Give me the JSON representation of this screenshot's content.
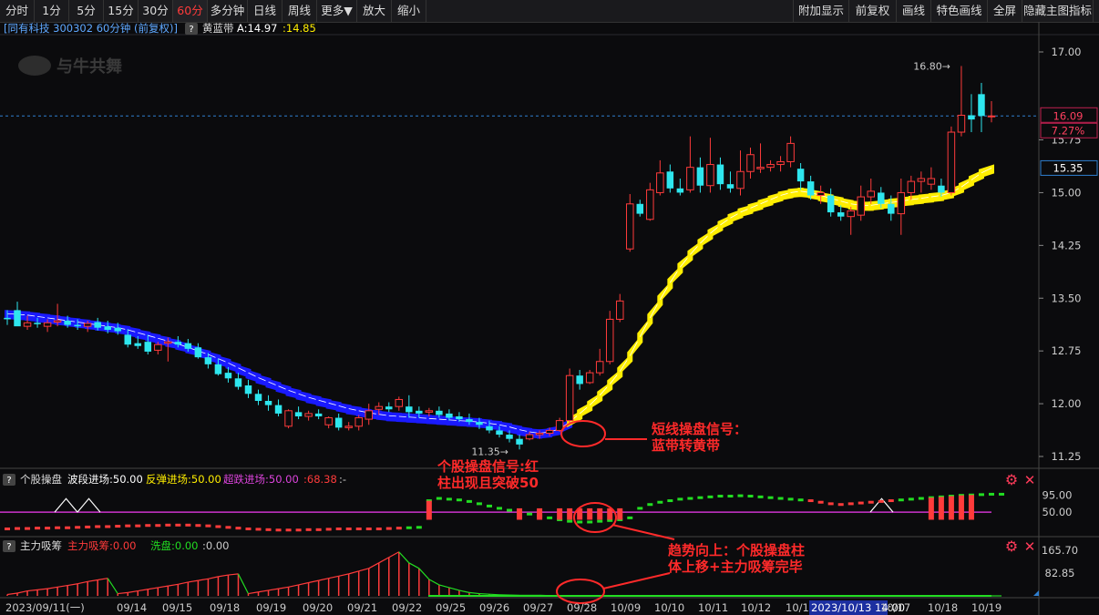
{
  "toolbar": {
    "left_items": [
      "分时",
      "1分",
      "5分",
      "15分",
      "30分",
      "60分",
      "多分钟",
      "日线",
      "周线",
      "更多▼",
      "放大",
      "缩小"
    ],
    "active_item": "60分",
    "right_items": [
      "附加显示",
      "前复权",
      "画线",
      "特色画线",
      "全屏",
      "隐藏主图指标"
    ]
  },
  "main_header": {
    "stock": "同有科技 300302 60分钟",
    "adjust": "(前复权)",
    "indicator": "黄蓝带",
    "indicator_a": "A:14.97",
    "indicator_b": ":14.85"
  },
  "watermark": "与牛共舞",
  "price_axis": {
    "ticks": [
      "17.00",
      "15.75",
      "15.00",
      "14.25",
      "13.50",
      "12.75",
      "12.00",
      "11.25"
    ],
    "last_price": "16.09",
    "last_pct": "7.27%",
    "band_value": "15.35"
  },
  "high_label": "16.80",
  "low_label": "11.35",
  "sub1_header": {
    "name": "个股操盘",
    "a_label": "波段进场:50.00",
    "b_label": "反弹进场:50.00",
    "c_label": "超跌进场:50.00",
    "d_label": ":68.38",
    "e_label": ":-"
  },
  "sub1_axis": [
    "95.00",
    "50.00"
  ],
  "sub2_header": {
    "name": "主力吸筹",
    "a_label": "主力吸筹:0.00",
    "b_label": "洗盘:0.00",
    "c_label": ":0.00"
  },
  "sub2_axis": [
    "165.70",
    "82.85"
  ],
  "date_axis": [
    "2023/09/11(一)",
    "09/14",
    "09/15",
    "09/18",
    "09/19",
    "09/20",
    "09/21",
    "09/22",
    "09/25",
    "09/26",
    "09/27",
    "09/28",
    "10/09",
    "10/10",
    "10/11",
    "10/12",
    "10/13",
    "2023/10/13 14:00",
    "10/17",
    "10/18",
    "10/19"
  ],
  "annotations": {
    "short_signal": [
      "短线操盘信号：",
      "蓝带转黄带"
    ],
    "stock_signal": [
      "个股操盘信号:红",
      "柱出现且突破50"
    ],
    "trend_signal": [
      "趋势向上：个股操盘柱",
      "体上移+主力吸筹完毕"
    ]
  },
  "colors": {
    "up": "#ff3b3b",
    "down": "#2ee6ee",
    "blue_band": "#1a1aff",
    "yellow_band": "#ffee00",
    "green": "#22dd22",
    "magenta": "#cc33cc",
    "annotation": "#ff2a2a"
  },
  "chart_data": {
    "type": "candlestick",
    "candles": [
      {
        "o": 13.22,
        "h": 13.33,
        "l": 13.12,
        "c": 13.2
      },
      {
        "o": 13.33,
        "h": 13.45,
        "l": 13.15,
        "c": 13.1
      },
      {
        "o": 13.1,
        "h": 13.25,
        "l": 13.05,
        "c": 13.15
      },
      {
        "o": 13.15,
        "h": 13.22,
        "l": 13.08,
        "c": 13.13
      },
      {
        "o": 13.1,
        "h": 13.2,
        "l": 13.02,
        "c": 13.15
      },
      {
        "o": 13.16,
        "h": 13.42,
        "l": 13.1,
        "c": 13.18
      },
      {
        "o": 13.18,
        "h": 13.25,
        "l": 13.08,
        "c": 13.12
      },
      {
        "o": 13.12,
        "h": 13.2,
        "l": 13.05,
        "c": 13.1
      },
      {
        "o": 13.1,
        "h": 13.18,
        "l": 13.02,
        "c": 13.14
      },
      {
        "o": 13.16,
        "h": 13.22,
        "l": 13.04,
        "c": 13.08
      },
      {
        "o": 13.1,
        "h": 13.18,
        "l": 13.0,
        "c": 13.05
      },
      {
        "o": 13.08,
        "h": 13.15,
        "l": 12.98,
        "c": 13.03
      },
      {
        "o": 12.98,
        "h": 13.06,
        "l": 12.8,
        "c": 12.84
      },
      {
        "o": 12.86,
        "h": 12.96,
        "l": 12.78,
        "c": 12.82
      },
      {
        "o": 12.88,
        "h": 12.98,
        "l": 12.7,
        "c": 12.74
      },
      {
        "o": 12.76,
        "h": 12.88,
        "l": 12.7,
        "c": 12.84
      },
      {
        "o": 12.86,
        "h": 12.94,
        "l": 12.6,
        "c": 12.88
      },
      {
        "o": 12.88,
        "h": 12.96,
        "l": 12.8,
        "c": 12.84
      },
      {
        "o": 12.86,
        "h": 12.92,
        "l": 12.74,
        "c": 12.78
      },
      {
        "o": 12.8,
        "h": 12.86,
        "l": 12.64,
        "c": 12.66
      },
      {
        "o": 12.66,
        "h": 12.72,
        "l": 12.5,
        "c": 12.56
      },
      {
        "o": 12.56,
        "h": 12.64,
        "l": 12.4,
        "c": 12.42
      },
      {
        "o": 12.44,
        "h": 12.52,
        "l": 12.3,
        "c": 12.36
      },
      {
        "o": 12.36,
        "h": 12.44,
        "l": 12.2,
        "c": 12.24
      },
      {
        "o": 12.26,
        "h": 12.34,
        "l": 12.08,
        "c": 12.14
      },
      {
        "o": 12.14,
        "h": 12.2,
        "l": 11.98,
        "c": 12.04
      },
      {
        "o": 12.04,
        "h": 12.12,
        "l": 11.9,
        "c": 11.98
      },
      {
        "o": 11.98,
        "h": 12.06,
        "l": 11.82,
        "c": 11.86
      },
      {
        "o": 11.68,
        "h": 11.92,
        "l": 11.65,
        "c": 11.9
      },
      {
        "o": 11.88,
        "h": 11.96,
        "l": 11.78,
        "c": 11.82
      },
      {
        "o": 11.82,
        "h": 11.9,
        "l": 11.76,
        "c": 11.86
      },
      {
        "o": 11.86,
        "h": 11.92,
        "l": 11.78,
        "c": 11.82
      },
      {
        "o": 11.7,
        "h": 11.82,
        "l": 11.65,
        "c": 11.8
      },
      {
        "o": 11.8,
        "h": 11.86,
        "l": 11.62,
        "c": 11.66
      },
      {
        "o": 11.66,
        "h": 11.74,
        "l": 11.62,
        "c": 11.68
      },
      {
        "o": 11.68,
        "h": 11.84,
        "l": 11.62,
        "c": 11.8
      },
      {
        "o": 11.78,
        "h": 12.0,
        "l": 11.7,
        "c": 11.9
      },
      {
        "o": 11.92,
        "h": 12.02,
        "l": 11.84,
        "c": 11.96
      },
      {
        "o": 11.96,
        "h": 12.02,
        "l": 11.88,
        "c": 11.92
      },
      {
        "o": 11.96,
        "h": 12.1,
        "l": 11.9,
        "c": 12.06
      },
      {
        "o": 11.96,
        "h": 12.12,
        "l": 11.8,
        "c": 11.88
      },
      {
        "o": 11.9,
        "h": 11.96,
        "l": 11.8,
        "c": 11.86
      },
      {
        "o": 11.88,
        "h": 11.94,
        "l": 11.82,
        "c": 11.9
      },
      {
        "o": 11.9,
        "h": 11.96,
        "l": 11.8,
        "c": 11.84
      },
      {
        "o": 11.86,
        "h": 11.92,
        "l": 11.76,
        "c": 11.8
      },
      {
        "o": 11.82,
        "h": 11.88,
        "l": 11.74,
        "c": 11.78
      },
      {
        "o": 11.78,
        "h": 11.86,
        "l": 11.7,
        "c": 11.74
      },
      {
        "o": 11.74,
        "h": 11.8,
        "l": 11.64,
        "c": 11.7
      },
      {
        "o": 11.68,
        "h": 11.76,
        "l": 11.58,
        "c": 11.62
      },
      {
        "o": 11.62,
        "h": 11.68,
        "l": 11.52,
        "c": 11.56
      },
      {
        "o": 11.56,
        "h": 11.62,
        "l": 11.45,
        "c": 11.5
      },
      {
        "o": 11.5,
        "h": 11.56,
        "l": 11.35,
        "c": 11.42
      },
      {
        "o": 11.5,
        "h": 11.6,
        "l": 11.48,
        "c": 11.56
      },
      {
        "o": 11.56,
        "h": 11.62,
        "l": 11.5,
        "c": 11.58
      },
      {
        "o": 11.58,
        "h": 11.66,
        "l": 11.54,
        "c": 11.62
      },
      {
        "o": 11.62,
        "h": 11.8,
        "l": 11.6,
        "c": 11.76
      },
      {
        "o": 11.76,
        "h": 12.5,
        "l": 11.72,
        "c": 12.4
      },
      {
        "o": 12.4,
        "h": 12.48,
        "l": 12.2,
        "c": 12.28
      },
      {
        "o": 12.3,
        "h": 12.48,
        "l": 12.28,
        "c": 12.44
      },
      {
        "o": 12.44,
        "h": 12.78,
        "l": 12.4,
        "c": 12.6
      },
      {
        "o": 12.6,
        "h": 13.32,
        "l": 12.56,
        "c": 13.2
      },
      {
        "o": 13.2,
        "h": 13.56,
        "l": 13.16,
        "c": 13.46
      },
      {
        "o": 14.2,
        "h": 14.98,
        "l": 14.16,
        "c": 14.84
      },
      {
        "o": 14.84,
        "h": 14.9,
        "l": 14.66,
        "c": 14.7
      },
      {
        "o": 14.62,
        "h": 15.14,
        "l": 14.6,
        "c": 15.04
      },
      {
        "o": 15.0,
        "h": 15.46,
        "l": 14.96,
        "c": 15.28
      },
      {
        "o": 15.3,
        "h": 15.4,
        "l": 15.0,
        "c": 15.06
      },
      {
        "o": 15.06,
        "h": 15.2,
        "l": 14.96,
        "c": 15.0
      },
      {
        "o": 15.04,
        "h": 15.8,
        "l": 15.0,
        "c": 15.36
      },
      {
        "o": 15.36,
        "h": 15.5,
        "l": 15.0,
        "c": 15.1
      },
      {
        "o": 15.1,
        "h": 15.78,
        "l": 15.0,
        "c": 15.4
      },
      {
        "o": 15.4,
        "h": 15.5,
        "l": 15.04,
        "c": 15.12
      },
      {
        "o": 15.12,
        "h": 15.3,
        "l": 15.0,
        "c": 15.06
      },
      {
        "o": 15.06,
        "h": 15.6,
        "l": 14.96,
        "c": 15.3
      },
      {
        "o": 15.3,
        "h": 15.64,
        "l": 15.2,
        "c": 15.54
      },
      {
        "o": 15.34,
        "h": 15.7,
        "l": 15.28,
        "c": 15.36
      },
      {
        "o": 15.36,
        "h": 15.46,
        "l": 15.3,
        "c": 15.4
      },
      {
        "o": 15.4,
        "h": 15.52,
        "l": 15.3,
        "c": 15.44
      },
      {
        "o": 15.44,
        "h": 15.8,
        "l": 15.36,
        "c": 15.7
      },
      {
        "o": 15.34,
        "h": 15.42,
        "l": 15.04,
        "c": 15.16
      },
      {
        "o": 15.16,
        "h": 15.24,
        "l": 14.9,
        "c": 14.96
      },
      {
        "o": 14.96,
        "h": 15.1,
        "l": 14.84,
        "c": 15.0
      },
      {
        "o": 14.96,
        "h": 15.06,
        "l": 14.66,
        "c": 14.72
      },
      {
        "o": 14.72,
        "h": 14.82,
        "l": 14.6,
        "c": 14.66
      },
      {
        "o": 14.66,
        "h": 14.8,
        "l": 14.4,
        "c": 14.74
      },
      {
        "o": 14.68,
        "h": 15.1,
        "l": 14.6,
        "c": 14.94
      },
      {
        "o": 14.94,
        "h": 15.2,
        "l": 14.84,
        "c": 15.02
      },
      {
        "o": 15.0,
        "h": 15.08,
        "l": 14.78,
        "c": 14.84
      },
      {
        "o": 14.84,
        "h": 14.96,
        "l": 14.6,
        "c": 14.7
      },
      {
        "o": 14.7,
        "h": 15.2,
        "l": 14.4,
        "c": 15.0
      },
      {
        "o": 15.0,
        "h": 15.24,
        "l": 14.9,
        "c": 15.16
      },
      {
        "o": 15.16,
        "h": 15.3,
        "l": 15.0,
        "c": 15.2
      },
      {
        "o": 15.12,
        "h": 15.36,
        "l": 15.04,
        "c": 15.2
      },
      {
        "o": 15.1,
        "h": 15.2,
        "l": 14.94,
        "c": 15.0
      },
      {
        "o": 15.0,
        "h": 15.94,
        "l": 14.96,
        "c": 15.86
      },
      {
        "o": 15.86,
        "h": 16.8,
        "l": 15.8,
        "c": 16.1
      },
      {
        "o": 16.1,
        "h": 16.4,
        "l": 15.86,
        "c": 16.04
      },
      {
        "o": 16.4,
        "h": 16.56,
        "l": 15.86,
        "c": 16.09
      },
      {
        "o": 16.09,
        "h": 16.3,
        "l": 16.0,
        "c": 16.09
      }
    ],
    "band": [
      13.28,
      13.27,
      13.26,
      13.24,
      13.22,
      13.2,
      13.18,
      13.16,
      13.14,
      13.12,
      13.1,
      13.08,
      13.05,
      13.01,
      12.97,
      12.93,
      12.89,
      12.85,
      12.8,
      12.75,
      12.7,
      12.64,
      12.58,
      12.51,
      12.44,
      12.37,
      12.31,
      12.25,
      12.19,
      12.14,
      12.09,
      12.05,
      12.01,
      11.97,
      11.93,
      11.9,
      11.87,
      11.85,
      11.83,
      11.82,
      11.81,
      11.8,
      11.79,
      11.78,
      11.77,
      11.76,
      11.75,
      11.74,
      11.72,
      11.7,
      11.67,
      11.63,
      11.6,
      11.58,
      11.6,
      11.64,
      11.74,
      11.86,
      11.98,
      12.12,
      12.28,
      12.46,
      12.68,
      12.95,
      13.22,
      13.48,
      13.72,
      13.94,
      14.12,
      14.28,
      14.42,
      14.54,
      14.64,
      14.72,
      14.78,
      14.84,
      14.9,
      14.96,
      15.0,
      15.02,
      15.0,
      14.96,
      14.92,
      14.88,
      14.84,
      14.82,
      14.82,
      14.84,
      14.86,
      14.88,
      14.9,
      14.92,
      14.94,
      14.96,
      15.0,
      15.08,
      15.18,
      15.28,
      15.35
    ],
    "band_color_change_index": 56,
    "sub1_level": 50,
    "sub1_range": [
      0,
      110
    ],
    "sub1_dots": [
      6,
      7,
      7,
      8,
      8,
      9,
      9,
      10,
      11,
      12,
      12,
      13,
      14,
      14,
      15,
      15,
      16,
      16,
      16,
      15,
      14,
      12,
      10,
      8,
      6,
      5,
      4,
      3,
      3,
      3,
      4,
      4,
      5,
      6,
      6,
      6,
      6,
      6,
      7,
      8,
      9,
      10,
      80,
      86,
      84,
      82,
      78,
      72,
      66,
      60,
      55,
      50,
      45,
      40,
      35,
      30,
      26,
      24,
      24,
      26,
      28,
      30,
      35,
      60,
      70,
      76,
      80,
      84,
      86,
      88,
      90,
      92,
      92,
      93,
      92,
      90,
      88,
      86,
      84,
      82,
      80,
      76,
      72,
      70,
      72,
      74,
      76,
      78,
      80,
      82,
      84,
      86,
      88,
      90,
      92,
      94,
      95,
      96,
      97,
      97
    ],
    "sub1_bar_indices": [
      42,
      51,
      53,
      55,
      56,
      57,
      58,
      59,
      60,
      61,
      92,
      93,
      94,
      95,
      96
    ],
    "sub2_range": [
      0,
      165.7
    ],
    "sub2_bars": [
      5,
      10,
      18,
      22,
      26,
      32,
      38,
      44,
      52,
      58,
      64,
      8,
      12,
      18,
      24,
      30,
      36,
      42,
      50,
      56,
      62,
      70,
      76,
      80,
      8,
      14,
      20,
      26,
      32,
      40,
      48,
      56,
      64,
      72,
      80,
      90,
      100,
      120,
      140,
      160,
      120,
      100,
      60,
      40,
      30,
      20,
      12,
      8,
      6,
      4,
      3,
      2,
      2,
      2,
      1,
      1,
      1,
      0,
      0,
      0,
      0,
      0,
      0,
      0,
      0,
      0,
      0,
      0,
      0,
      0,
      0,
      0,
      0,
      0,
      0,
      0,
      0,
      0,
      0,
      0,
      0,
      0,
      0,
      0,
      0,
      0,
      0,
      0,
      0,
      0,
      0,
      0,
      0,
      0,
      0,
      0,
      0,
      0,
      0,
      0
    ]
  }
}
